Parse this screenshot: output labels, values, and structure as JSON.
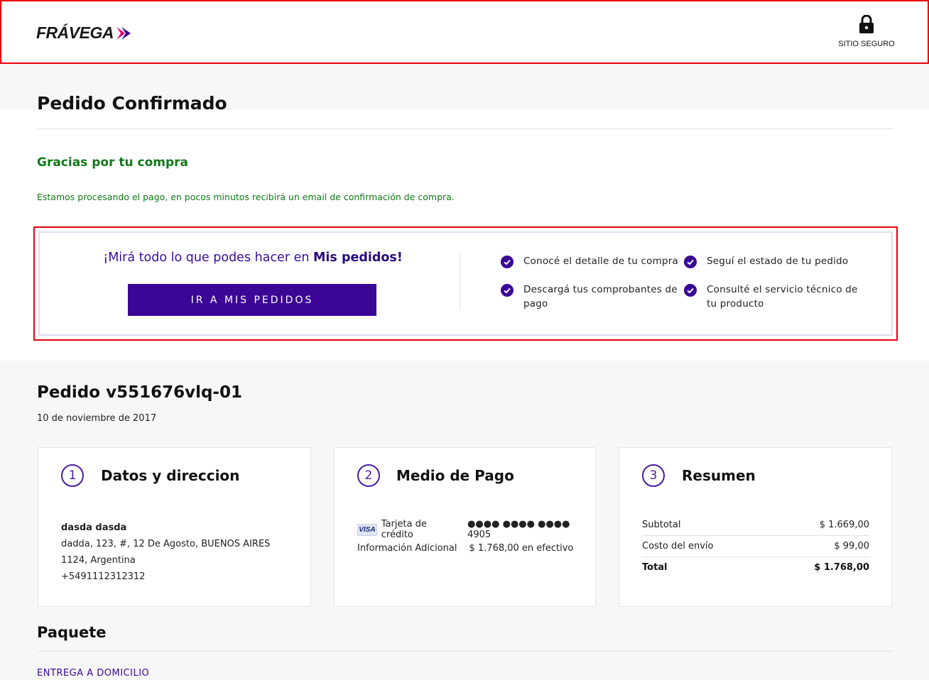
{
  "header": {
    "brand": "FRÁVEGA",
    "secure_label": "SITIO SEGURO",
    "secure_icon": "lock-icon"
  },
  "confirmation": {
    "title": "Pedido Confirmado",
    "thanks": "Gracias por tu compra",
    "processing": "Estamos procesando el pago, en pocos minutos recibirá un email de confirmación de compra."
  },
  "promo": {
    "lead_prefix": "¡Mirá todo lo que podes hacer en ",
    "lead_bold": "Mis pedidos!",
    "button_label": "IR A MIS PEDIDOS",
    "features": [
      "Conocé el detalle de tu compra",
      "Seguí el estado de tu pedido",
      "Descargá tus comprobantes de pago",
      "Consulté el servicio técnico de tu producto"
    ]
  },
  "order": {
    "title": "Pedido v551676vlq-01",
    "date": "10 de noviembre de 2017"
  },
  "cards": {
    "address": {
      "step": "1",
      "title": "Datos y direccion",
      "name": "dasda dasda",
      "street": "dadda, 123, #, 12 De Agosto, BUENOS AIRES",
      "city": "1124, Argentina",
      "phone": "+5491112312312"
    },
    "payment": {
      "step": "2",
      "title": "Medio de Pago",
      "card_brand": "VISA",
      "card_label": "Tarjeta de crédito",
      "card_number": "●●●● ●●●● ●●●● 4905",
      "extra_label": "Información Adicional",
      "extra_value": "$ 1.768,00 en efectivo"
    },
    "summary": {
      "step": "3",
      "title": "Resumen",
      "rows": [
        {
          "label": "Subtotal",
          "value": "$ 1.669,00"
        },
        {
          "label": "Costo del envío",
          "value": "$ 99,00"
        },
        {
          "label": "Total",
          "value": "$ 1.768,00"
        }
      ]
    }
  },
  "package": {
    "title": "Paquete",
    "delivery": "ENTREGA A DOMICILIO"
  },
  "colors": {
    "brand_purple": "#3b0596",
    "success_green": "#0f7a17",
    "highlight_red": "#e8000d"
  }
}
